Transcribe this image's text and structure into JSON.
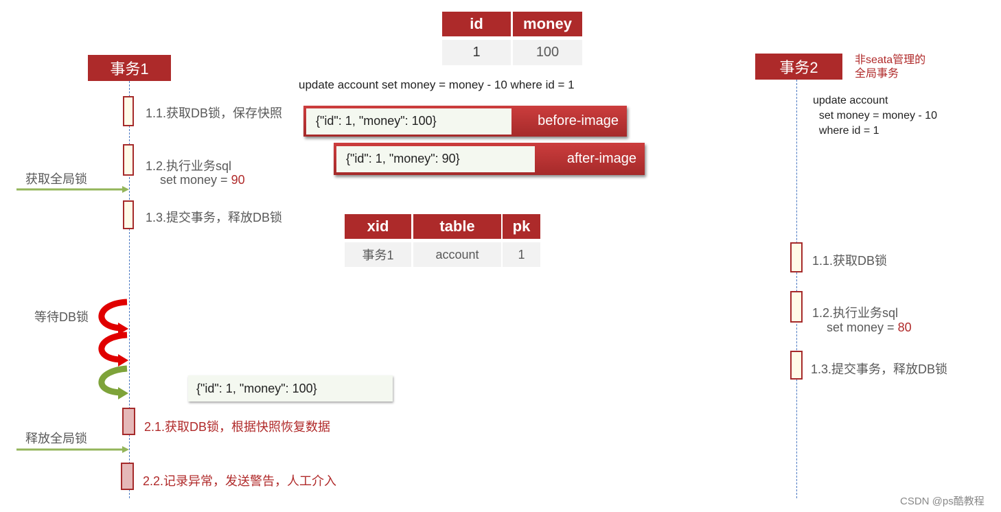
{
  "tx1": {
    "title": "事务1",
    "steps": [
      "1.1.获取DB锁，保存快照",
      "1.2.执行业务sql",
      "1.3.提交事务，释放DB锁"
    ],
    "sql_prefix": "set money = ",
    "sql_value": "90",
    "acquire_global": "获取全局锁",
    "wait_db": "等待DB锁",
    "release_global": "释放全局锁",
    "rollback_steps": [
      "2.1.获取DB锁，根据快照恢复数据",
      "2.2.记录异常，发送警告，人工介入"
    ],
    "snapshot": "{\"id\": 1, \"money\": 100}"
  },
  "tx2": {
    "title": "事务2",
    "note": "非seata管理的\n全局事务",
    "sql": [
      "update account",
      "  set money = money - 10",
      "  where id = 1"
    ],
    "steps": [
      "1.1.获取DB锁",
      "1.2.执行业务sql",
      "1.3.提交事务，释放DB锁"
    ],
    "sql_prefix": "set money = ",
    "sql_value": "80"
  },
  "account_table": {
    "headers": [
      "id",
      "money"
    ],
    "row": [
      "1",
      "100"
    ]
  },
  "update_sql": "update account set money = money - 10 where id = 1",
  "before_image": {
    "json": "{\"id\": 1, \"money\": 100}",
    "label": "before-image"
  },
  "after_image": {
    "json": "{\"id\": 1, \"money\": 90}",
    "label": "after-image"
  },
  "lock_table": {
    "headers": [
      "xid",
      "table",
      "pk"
    ],
    "row": [
      "事务1",
      "account",
      "1"
    ]
  },
  "watermark": "CSDN @ps酷教程",
  "colors": {
    "header": "#ad2a2a",
    "wait_arrow": "#e00000",
    "release_arrow": "#7ea33a",
    "global_lock_arrow": "#93b55a"
  }
}
